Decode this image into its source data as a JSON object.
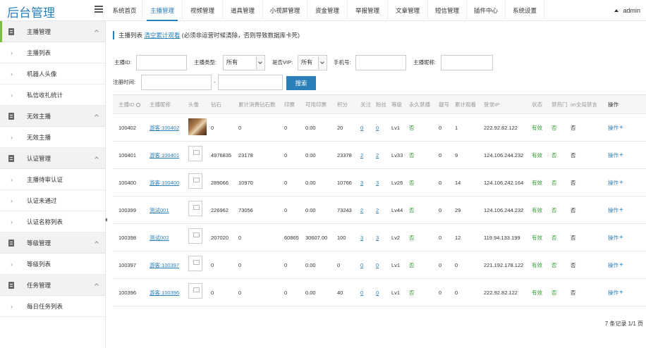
{
  "app": {
    "title": "后台管理"
  },
  "header": {
    "tabs": [
      {
        "label": "系统首页",
        "active": false
      },
      {
        "label": "主播管理",
        "active": true
      },
      {
        "label": "视频管理",
        "active": false
      },
      {
        "label": "道具管理",
        "active": false
      },
      {
        "label": "小视屏管理",
        "active": false
      },
      {
        "label": "资金管理",
        "active": false
      },
      {
        "label": "举报管理",
        "active": false
      },
      {
        "label": "文章管理",
        "active": false
      },
      {
        "label": "短信管理",
        "active": false
      },
      {
        "label": "插件中心",
        "active": false
      },
      {
        "label": "系统设置",
        "active": false
      }
    ],
    "user": "admin"
  },
  "sidebar": {
    "groups": [
      {
        "label": "主播管理",
        "items": [
          "主播列表",
          "机器人头像",
          "私信收礼统计"
        ]
      },
      {
        "label": "无效主播",
        "items": [
          "无效主播"
        ]
      },
      {
        "label": "认证管理",
        "items": [
          "主播待审认证",
          "认证未通过",
          "认证名称列表"
        ]
      },
      {
        "label": "等级管理",
        "items": [
          "等级列表"
        ]
      },
      {
        "label": "任务管理",
        "items": [
          "每日任务列表"
        ]
      }
    ]
  },
  "breadcrumb": {
    "title": "主播列表",
    "action": "清空累计观看",
    "note": "(必须非运营时候清除，否则导致数据库卡死)"
  },
  "filters": {
    "anchor_id_label": "主播ID:",
    "anchor_type_label": "主播类型:",
    "anchor_type_value": "所有",
    "vip_label": "是否VIP:",
    "vip_value": "所有",
    "phone_label": "手机号:",
    "nickname_label": "主播昵称:",
    "reg_time_label": "注册时间:",
    "date_separator": "-",
    "search_label": "搜索"
  },
  "table": {
    "columns": [
      "主播ID",
      "主播昵称",
      "头像",
      "钻石",
      "累计消费钻石数",
      "印票",
      "可用印票",
      "积分",
      "关注",
      "粉丝",
      "等级",
      "永久禁播",
      "靓号",
      "累计观看",
      "登录IP",
      "状态",
      "禁热门",
      "im全局禁言",
      "操作"
    ],
    "rows": [
      {
        "id": "100402",
        "nickname": "游客:100402",
        "avatar": "photo",
        "diamonds": "0",
        "total_spent": "0",
        "tickets": "0",
        "avail_tickets": "0.00",
        "points": "20",
        "follows": "0",
        "fans": "0",
        "level": "Lv1",
        "banned": "否",
        "pretty": "0",
        "views": "1",
        "ip": "222.92.82.122",
        "status": "有效",
        "hot_ban": "否",
        "im_mute": "否",
        "op": "操作"
      },
      {
        "id": "100401",
        "nickname": "游客:100401",
        "avatar": "placeholder",
        "diamonds": "4976835",
        "total_spent": "23178",
        "tickets": "0",
        "avail_tickets": "0.00",
        "points": "23378",
        "follows": "2",
        "fans": "2",
        "level": "Lv33",
        "banned": "否",
        "pretty": "0",
        "views": "9",
        "ip": "124.106.244.232",
        "status": "有效",
        "hot_ban": "否",
        "im_mute": "否",
        "op": "操作"
      },
      {
        "id": "100400",
        "nickname": "游客:100400",
        "avatar": "placeholder",
        "diamonds": "289066",
        "total_spent": "10970",
        "tickets": "0",
        "avail_tickets": "0.00",
        "points": "10766",
        "follows": "3",
        "fans": "3",
        "level": "Lv26",
        "banned": "否",
        "pretty": "0",
        "views": "14",
        "ip": "124.106.242.164",
        "status": "有效",
        "hot_ban": "否",
        "im_mute": "否",
        "op": "操作"
      },
      {
        "id": "100399",
        "nickname": "测试001",
        "avatar": "placeholder",
        "diamonds": "226962",
        "total_spent": "73056",
        "tickets": "0",
        "avail_tickets": "0.00",
        "points": "73243",
        "follows": "2",
        "fans": "2",
        "level": "Lv44",
        "banned": "否",
        "pretty": "0",
        "views": "29",
        "ip": "124.106.244.232",
        "status": "有效",
        "hot_ban": "否",
        "im_mute": "否",
        "op": "操作"
      },
      {
        "id": "100398",
        "nickname": "测试002",
        "avatar": "placeholder",
        "diamonds": "207020",
        "total_spent": "0",
        "tickets": "60865",
        "avail_tickets": "30607.00",
        "points": "100",
        "follows": "3",
        "fans": "3",
        "level": "Lv2",
        "banned": "否",
        "pretty": "0",
        "views": "12",
        "ip": "119.94.133.199",
        "status": "有效",
        "hot_ban": "否",
        "im_mute": "否",
        "op": "操作"
      },
      {
        "id": "100397",
        "nickname": "游客:100397",
        "avatar": "placeholder",
        "diamonds": "0",
        "total_spent": "0",
        "tickets": "0",
        "avail_tickets": "0.00",
        "points": "0",
        "follows": "0",
        "fans": "0",
        "level": "Lv1",
        "banned": "否",
        "pretty": "0",
        "views": "0",
        "ip": "221.192.178.122",
        "status": "有效",
        "hot_ban": "否",
        "im_mute": "否",
        "op": "操作"
      },
      {
        "id": "100396",
        "nickname": "游客:100396",
        "avatar": "placeholder",
        "diamonds": "0",
        "total_spent": "0",
        "tickets": "0",
        "avail_tickets": "0.00",
        "points": "40",
        "follows": "0",
        "fans": "0",
        "level": "Lv1",
        "banned": "否",
        "pretty": "0",
        "views": "0",
        "ip": "222.92.82.122",
        "status": "有效",
        "hot_ban": "否",
        "im_mute": "否",
        "op": "操作"
      }
    ]
  },
  "pagination": {
    "text": "7 条记录 1/1 页"
  },
  "colors": {
    "accent": "#2a7fb8",
    "ok": "#2e9e2e",
    "sidebar_marker": "#7cbf3a"
  }
}
